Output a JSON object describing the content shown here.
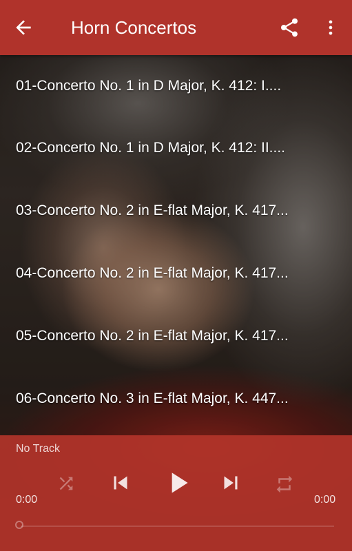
{
  "app_bar": {
    "title": "Horn Concertos",
    "back_icon": "arrow-back-icon",
    "share_icon": "share-icon",
    "more_icon": "more-vert-icon",
    "color": "#b0332b"
  },
  "tracks": [
    {
      "label": "01-Concerto No. 1 in D Major, K. 412: I...."
    },
    {
      "label": "02-Concerto No. 1 in D Major, K. 412: II...."
    },
    {
      "label": "03-Concerto No. 2 in E-flat Major, K. 417..."
    },
    {
      "label": "04-Concerto No. 2 in E-flat Major, K. 417..."
    },
    {
      "label": "05-Concerto No. 2 in E-flat Major, K. 417..."
    },
    {
      "label": "06-Concerto No. 3 in E-flat Major, K. 447..."
    }
  ],
  "player": {
    "now_playing": "No Track",
    "elapsed": "0:00",
    "duration": "0:00",
    "progress": 0,
    "icons": {
      "shuffle": "shuffle-icon",
      "previous": "skip-previous-icon",
      "play": "play-icon",
      "next": "skip-next-icon",
      "repeat": "repeat-icon"
    }
  }
}
